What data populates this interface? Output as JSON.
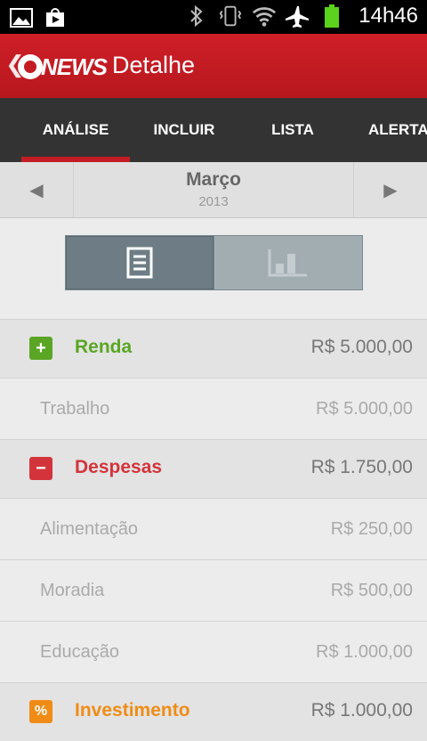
{
  "status_bar": {
    "time": "14h46",
    "icons": [
      "image-icon",
      "play-store-icon",
      "bluetooth-icon",
      "vibrate-icon",
      "wifi-icon",
      "airplane-icon",
      "battery-icon"
    ]
  },
  "action_bar": {
    "logo_text": "NEWS",
    "title": "Detalhe",
    "back_glyph": "❮"
  },
  "tabs": [
    {
      "label": "ANÁLISE",
      "active": true
    },
    {
      "label": "INCLUIR",
      "active": false
    },
    {
      "label": "LISTA",
      "active": false
    },
    {
      "label": "ALERTAS",
      "active": false
    }
  ],
  "month_selector": {
    "month": "Março",
    "year": "2013",
    "prev_glyph": "◀",
    "next_glyph": "▶"
  },
  "view_toggle": {
    "selected": "list-view",
    "options": [
      "list-view-icon",
      "chart-view-icon"
    ]
  },
  "categories": [
    {
      "name": "Renda",
      "amount": "R$ 5.000,00",
      "badge": "+",
      "color": "#5aa624",
      "items": [
        {
          "name": "Trabalho",
          "amount": "R$ 5.000,00"
        }
      ]
    },
    {
      "name": "Despesas",
      "amount": "R$ 1.750,00",
      "badge": "−",
      "color": "#d3343c",
      "items": [
        {
          "name": "Alimentação",
          "amount": "R$ 250,00"
        },
        {
          "name": "Moradia",
          "amount": "R$ 500,00"
        },
        {
          "name": "Educação",
          "amount": "R$ 1.000,00"
        }
      ]
    },
    {
      "name": "Investimento",
      "amount": "R$ 1.000,00",
      "badge": "%",
      "color": "#f08c16",
      "items": []
    }
  ]
}
